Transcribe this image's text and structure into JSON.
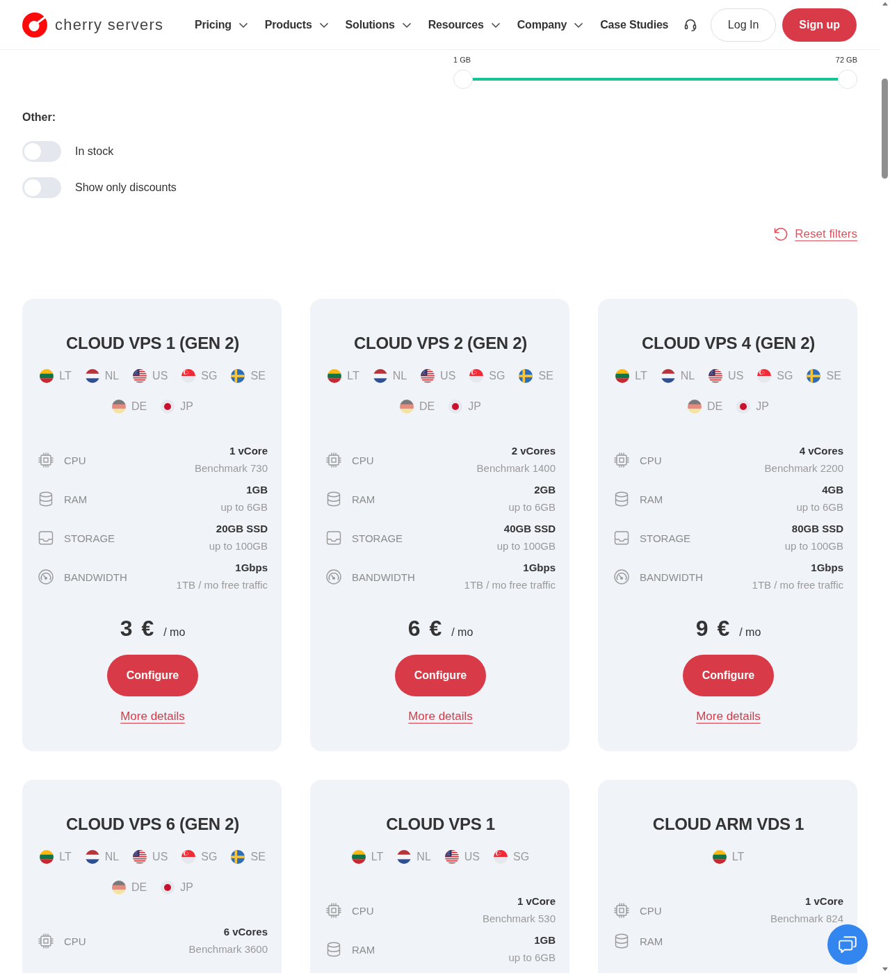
{
  "header": {
    "logo_text": "cherry servers",
    "nav": [
      {
        "label": "Pricing",
        "has_menu": true
      },
      {
        "label": "Products",
        "has_menu": true
      },
      {
        "label": "Solutions",
        "has_menu": true
      },
      {
        "label": "Resources",
        "has_menu": true
      },
      {
        "label": "Company",
        "has_menu": true
      },
      {
        "label": "Case Studies",
        "has_menu": false
      }
    ],
    "login": "Log In",
    "signup": "Sign up"
  },
  "memory_filter": {
    "min_label": "1 GB",
    "max_label": "72 GB",
    "handles": [
      {
        "level": 0
      },
      {
        "level": 1
      }
    ]
  },
  "other": {
    "title": "Other:",
    "toggles": [
      {
        "label": "In stock",
        "on": false
      },
      {
        "label": "Show only discounts",
        "on": false
      }
    ]
  },
  "reset_filters": "Reset filters",
  "plans": [
    {
      "title": "CLOUD VPS 1 (GEN 2)",
      "locations": [
        {
          "code": "LT",
          "kind": "lithuania"
        },
        {
          "code": "NL",
          "kind": "netherlands"
        },
        {
          "code": "US",
          "kind": "united-states"
        },
        {
          "code": "SG",
          "kind": "singapore"
        },
        {
          "code": "SE",
          "kind": "sweden"
        },
        {
          "code": "DE",
          "kind": "germany"
        },
        {
          "code": "JP",
          "kind": "japan"
        }
      ],
      "specs": [
        {
          "kind": "cpu",
          "label": "CPU",
          "value": "1 vCore",
          "detail": "Benchmark 730"
        },
        {
          "kind": "ram",
          "label": "RAM",
          "value": "1GB",
          "detail": "up to 6GB"
        },
        {
          "kind": "storage",
          "label": "STORAGE",
          "value": "20GB SSD",
          "detail": "up to 100GB"
        },
        {
          "kind": "bandwidth",
          "label": "BANDWIDTH",
          "value": "1Gbps",
          "detail": "1TB / mo free traffic"
        }
      ],
      "price": "3 €",
      "period": "/ mo",
      "configure": "Configure",
      "details_link": "More details"
    },
    {
      "title": "CLOUD VPS 2 (GEN 2)",
      "locations": [
        {
          "code": "LT",
          "kind": "lithuania"
        },
        {
          "code": "NL",
          "kind": "netherlands"
        },
        {
          "code": "US",
          "kind": "united-states"
        },
        {
          "code": "SG",
          "kind": "singapore"
        },
        {
          "code": "SE",
          "kind": "sweden"
        },
        {
          "code": "DE",
          "kind": "germany"
        },
        {
          "code": "JP",
          "kind": "japan"
        }
      ],
      "specs": [
        {
          "kind": "cpu",
          "label": "CPU",
          "value": "2 vCores",
          "detail": "Benchmark 1400"
        },
        {
          "kind": "ram",
          "label": "RAM",
          "value": "2GB",
          "detail": "up to 6GB"
        },
        {
          "kind": "storage",
          "label": "STORAGE",
          "value": "40GB SSD",
          "detail": "up to 100GB"
        },
        {
          "kind": "bandwidth",
          "label": "BANDWIDTH",
          "value": "1Gbps",
          "detail": "1TB / mo free traffic"
        }
      ],
      "price": "6 €",
      "period": "/ mo",
      "configure": "Configure",
      "details_link": "More details"
    },
    {
      "title": "CLOUD VPS 4 (GEN 2)",
      "locations": [
        {
          "code": "LT",
          "kind": "lithuania"
        },
        {
          "code": "NL",
          "kind": "netherlands"
        },
        {
          "code": "US",
          "kind": "united-states"
        },
        {
          "code": "SG",
          "kind": "singapore"
        },
        {
          "code": "SE",
          "kind": "sweden"
        },
        {
          "code": "DE",
          "kind": "germany"
        },
        {
          "code": "JP",
          "kind": "japan"
        }
      ],
      "specs": [
        {
          "kind": "cpu",
          "label": "CPU",
          "value": "4 vCores",
          "detail": "Benchmark 2200"
        },
        {
          "kind": "ram",
          "label": "RAM",
          "value": "4GB",
          "detail": "up to 6GB"
        },
        {
          "kind": "storage",
          "label": "STORAGE",
          "value": "80GB SSD",
          "detail": "up to 100GB"
        },
        {
          "kind": "bandwidth",
          "label": "BANDWIDTH",
          "value": "1Gbps",
          "detail": "1TB / mo free traffic"
        }
      ],
      "price": "9 €",
      "period": "/ mo",
      "configure": "Configure",
      "details_link": "More details"
    },
    {
      "title": "CLOUD VPS 6 (GEN 2)",
      "locations": [
        {
          "code": "LT",
          "kind": "lithuania"
        },
        {
          "code": "NL",
          "kind": "netherlands"
        },
        {
          "code": "US",
          "kind": "united-states"
        },
        {
          "code": "SG",
          "kind": "singapore"
        },
        {
          "code": "SE",
          "kind": "sweden"
        },
        {
          "code": "DE",
          "kind": "germany"
        },
        {
          "code": "JP",
          "kind": "japan"
        }
      ],
      "specs": [
        {
          "kind": "cpu",
          "label": "CPU",
          "value": "6 vCores",
          "detail": "Benchmark 3600"
        }
      ]
    },
    {
      "title": "CLOUD VPS 1",
      "locations": [
        {
          "code": "LT",
          "kind": "lithuania"
        },
        {
          "code": "NL",
          "kind": "netherlands"
        },
        {
          "code": "US",
          "kind": "united-states"
        },
        {
          "code": "SG",
          "kind": "singapore"
        }
      ],
      "specs": [
        {
          "kind": "cpu",
          "label": "CPU",
          "value": "1 vCore",
          "detail": "Benchmark 530"
        },
        {
          "kind": "ram",
          "label": "RAM",
          "value": "1GB",
          "detail": "up to 6GB"
        }
      ]
    },
    {
      "title": "CLOUD ARM VDS 1",
      "locations": [
        {
          "code": "LT",
          "kind": "lithuania"
        }
      ],
      "specs": [
        {
          "kind": "cpu",
          "label": "CPU",
          "value": "1 vCore",
          "detail": "Benchmark 824"
        },
        {
          "kind": "ram",
          "label": "RAM"
        }
      ]
    }
  ]
}
